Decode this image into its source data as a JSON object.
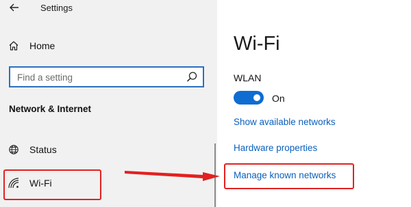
{
  "window": {
    "title": "Settings",
    "back_icon": "back-arrow-icon"
  },
  "sidebar": {
    "home_label": "Home",
    "home_icon": "home-icon",
    "search": {
      "placeholder": "Find a setting",
      "value": "",
      "icon": "search-icon"
    },
    "section_heading": "Network & Internet",
    "items": [
      {
        "label": "Status",
        "icon": "globe-icon",
        "selected": false
      },
      {
        "label": "Wi-Fi",
        "icon": "wifi-icon",
        "selected": true
      }
    ]
  },
  "main": {
    "title": "Wi-Fi",
    "wlan": {
      "label": "WLAN",
      "state_label": "On",
      "enabled": true
    },
    "links": {
      "show_networks": "Show available networks",
      "hardware_properties": "Hardware properties",
      "manage_networks": "Manage known networks"
    }
  },
  "annotation": {
    "color": "#e32020",
    "highlighted": [
      "Wi-Fi",
      "Manage known networks"
    ]
  }
}
